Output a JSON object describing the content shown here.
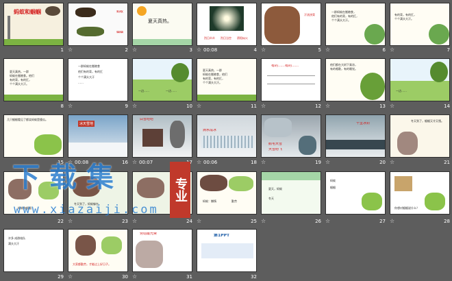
{
  "slides": [
    {
      "num": "1",
      "time": "",
      "title": "蚂蚁和蝈蝈",
      "lines": []
    },
    {
      "num": "2",
      "time": "",
      "title": "",
      "lines": [
        "蚂蚁",
        "蝈蝈"
      ]
    },
    {
      "num": "3",
      "time": "",
      "title": "夏天真热。",
      "lines": []
    },
    {
      "num": "4",
      "time": "00:08",
      "title": "",
      "lines": [
        "烈日炎炎",
        "烈日当空",
        "骄阳似火"
      ]
    },
    {
      "num": "5",
      "time": "",
      "title": "",
      "lines": [
        "汗流浃背"
      ]
    },
    {
      "num": "6",
      "time": "",
      "title": "",
      "lines": [
        "一群蚂蚁在搬粮食，",
        "他们有的背，有的扛，",
        "个个满头大汗。"
      ]
    },
    {
      "num": "7",
      "time": "",
      "title": "",
      "lines": [
        "有的背，有的扛，",
        "个个满头大汗。"
      ]
    },
    {
      "num": "8",
      "time": "",
      "title": "",
      "lines": [
        "夏天真热，一群",
        "蚂蚁在搬粮食。他们",
        "有的背，有的扛，",
        "个个满头大汗。"
      ]
    },
    {
      "num": "9",
      "time": "",
      "title": "",
      "lines": [
        "一群蚂蚁在搬粮食",
        "他们有的背，有的扛",
        "个个满头大汗",
        "……"
      ]
    },
    {
      "num": "10",
      "time": "",
      "title": "",
      "lines": [
        "一边……",
        "一边……"
      ]
    },
    {
      "num": "11",
      "time": "",
      "title": "",
      "lines": [
        "夏天真热，一群",
        "蚂蚁在搬粮食，他们",
        "有的背，有的扛，",
        "个个满头大汗。"
      ]
    },
    {
      "num": "12",
      "time": "",
      "title": "有的……有的……",
      "lines": []
    },
    {
      "num": "13",
      "time": "",
      "title": "",
      "lines": [
        "他们都在大树下乘凉，",
        "有的唱歌，有的睡觉。"
      ]
    },
    {
      "num": "14",
      "time": "",
      "title": "",
      "lines": [
        "一边……"
      ]
    },
    {
      "num": "15",
      "time": "",
      "title": "",
      "lines": [
        "几只蝈蝈看见了都笑蚂蚁是傻瓜。"
      ]
    },
    {
      "num": "16",
      "time": "00:08",
      "title": "冰天雪地",
      "lines": []
    },
    {
      "num": "17",
      "time": "00:07",
      "title": "白雪皑皑",
      "lines": []
    },
    {
      "num": "18",
      "time": "00:06",
      "title": "滴水成冰",
      "lines": []
    },
    {
      "num": "19",
      "time": "",
      "title": "鹅毛大雪",
      "lines": [
        "大雪纷飞"
      ]
    },
    {
      "num": "20",
      "time": "",
      "title": "千里冰封",
      "lines": []
    },
    {
      "num": "21",
      "time": "",
      "title": "",
      "lines": [
        "冬天到了，蝈蝈又冷又饿。"
      ]
    },
    {
      "num": "22",
      "time": "",
      "title": "",
      "lines": [
        "蚂蚁和蝈蝈"
      ]
    },
    {
      "num": "23",
      "time": "",
      "title": "",
      "lines": [
        "冬天到了，蚂蚁躲在"
      ]
    },
    {
      "num": "24",
      "time": "",
      "title": "",
      "lines": []
    },
    {
      "num": "25",
      "time": "",
      "title": "",
      "lines": [
        "蚂蚁：懒惰",
        "勤劳"
      ]
    },
    {
      "num": "26",
      "time": "",
      "title": "",
      "lines": [
        "夏天，蚂蚁",
        "冬天"
      ]
    },
    {
      "num": "27",
      "time": "",
      "title": "",
      "lines": [
        "蚂蚁",
        "蝈蝈"
      ]
    },
    {
      "num": "28",
      "time": "",
      "title": "",
      "lines": [
        "你想对蝈蝈说什么？"
      ]
    },
    {
      "num": "29",
      "time": "",
      "title": "",
      "lines": [
        "许多 成群结队",
        "满头大汗"
      ]
    },
    {
      "num": "30",
      "time": "",
      "title": "",
      "lines": [
        "大家都勤劳，才能过上好日子。"
      ]
    },
    {
      "num": "31",
      "time": "",
      "title": "劳动最光荣",
      "lines": []
    },
    {
      "num": "32",
      "time": "",
      "title": "第1PPT",
      "lines": []
    }
  ],
  "watermark": {
    "text": "下载集",
    "badge": "专业",
    "url": "www.xiazaiji.com"
  },
  "icons": {
    "slide_transition": "star-icon"
  },
  "colors": {
    "background": "#5d5d5d",
    "thumb_border": "#2e2e2e",
    "watermark": "#2c7fd0"
  }
}
